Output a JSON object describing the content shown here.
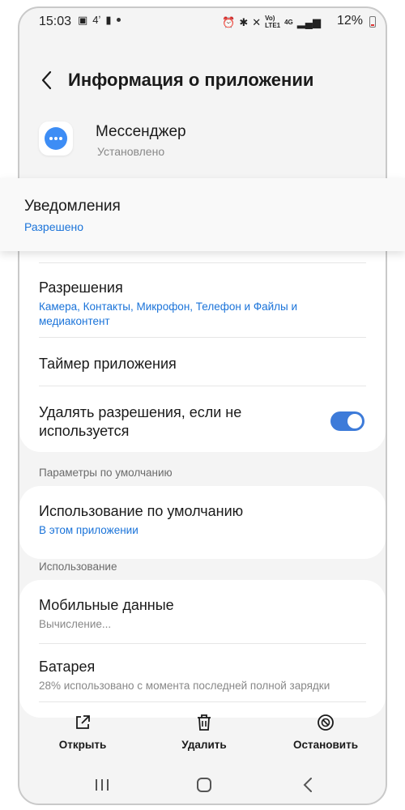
{
  "status_bar": {
    "time": "15:03",
    "battery_percent": "12%",
    "network_type_top": "Vo)",
    "network_type_bottom": "LTE1",
    "network_gen": "4G"
  },
  "header": {
    "title": "Информация о приложении"
  },
  "app": {
    "name": "Мессенджер",
    "status": "Установлено",
    "icon_color": "#3d8df5"
  },
  "notifications": {
    "title": "Уведомления",
    "value": "Разрешено"
  },
  "permissions": {
    "title": "Разрешения",
    "value": "Камера, Контакты, Микрофон, Телефон и Файлы и медиаконтент"
  },
  "app_timer": {
    "title": "Таймер приложения"
  },
  "remove_permissions": {
    "title": "Удалять разрешения, если не используется",
    "enabled": true
  },
  "defaults_section": {
    "label": "Параметры по умолчанию",
    "item_title": "Использование по умолчанию",
    "item_value": "В этом приложении"
  },
  "usage_section": {
    "label": "Использование",
    "mobile_data_title": "Мобильные данные",
    "mobile_data_value": "Вычисление...",
    "battery_title": "Батарея",
    "battery_value": "28% использовано с момента последней полной зарядки"
  },
  "actions": {
    "open_label": "Открыть",
    "delete_label": "Удалить",
    "stop_label": "Остановить"
  },
  "colors": {
    "accent": "#1a73d9",
    "toggle_on": "#3d7bd9",
    "background": "#f4f4f4"
  }
}
